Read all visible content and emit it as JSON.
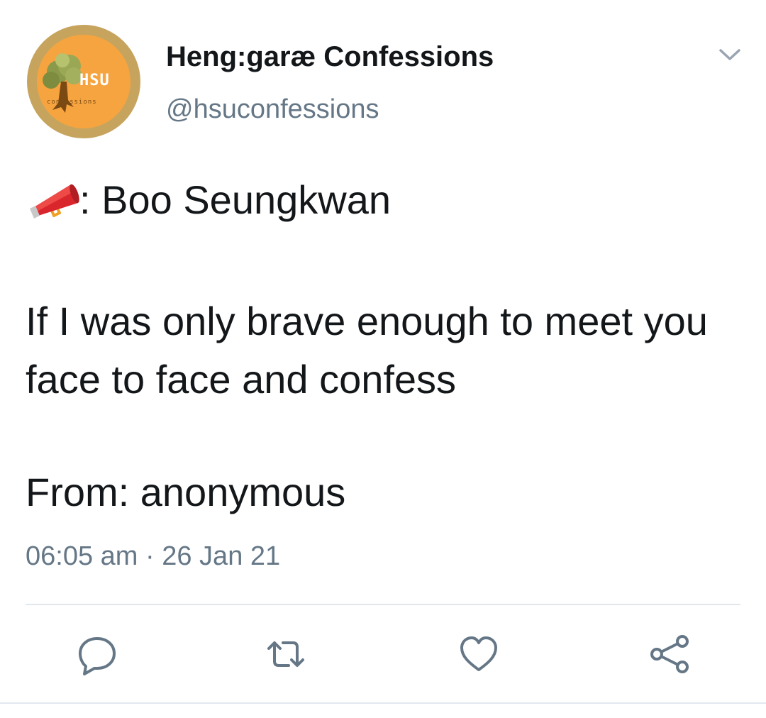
{
  "account": {
    "display_name": "Heng:garæ Confessions",
    "handle": "@hsuconfessions",
    "avatar_text": "HSU",
    "avatar_subtext": "confessions",
    "avatar_colors": {
      "ring": "#c7a45e",
      "fill": "#f6a440"
    }
  },
  "tweet": {
    "line1_icon": "megaphone-icon",
    "line1_text": ": Boo Seungkwan",
    "body": "If I was only brave enough to meet you face to face and confess",
    "from": "From: anonymous",
    "time": "06:05 am",
    "separator": " · ",
    "date": "26 Jan 21"
  },
  "actions": {
    "reply_icon": "reply-icon",
    "retweet_icon": "retweet-icon",
    "like_icon": "heart-icon",
    "share_icon": "share-icon"
  },
  "colors": {
    "text_primary": "#14171a",
    "text_secondary": "#657786",
    "divider": "#e1e8ed",
    "icon": "#657786"
  }
}
